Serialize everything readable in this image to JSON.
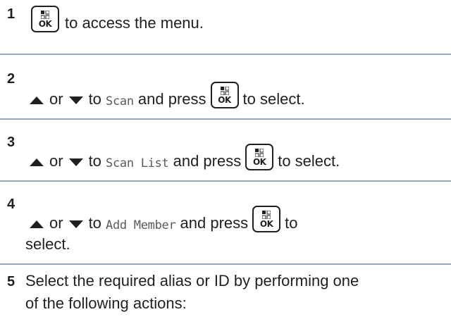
{
  "key_label": "OK",
  "steps": [
    {
      "number": "1",
      "text_after_key": "to access the menu."
    },
    {
      "number": "2",
      "or": "or",
      "to": "to",
      "menu_item": "Scan",
      "and_press": "and press",
      "to_select": "to select."
    },
    {
      "number": "3",
      "or": "or",
      "to": "to",
      "menu_item": "Scan List",
      "and_press": "and press",
      "to_select": "to select."
    },
    {
      "number": "4",
      "or": "or",
      "to": "to",
      "menu_item": "Add Member",
      "and_press": "and press",
      "select": "select."
    },
    {
      "number": "5",
      "line1": "Select the required alias or ID by performing one",
      "line2": "of the following actions:"
    }
  ]
}
